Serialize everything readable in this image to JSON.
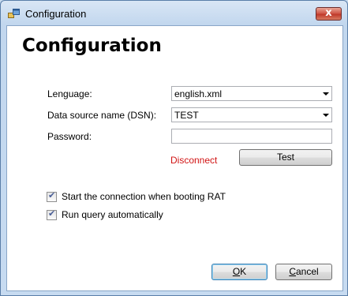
{
  "window": {
    "title": "Configuration",
    "close_glyph": "x",
    "icon": "app-window-icon"
  },
  "heading": "Configuration",
  "form": {
    "language_label": "Lenguage:",
    "language_value": "english.xml",
    "dsn_label": "Data source name (DSN):",
    "dsn_value": "TEST",
    "password_label": "Password:",
    "password_value": "",
    "status_text": "Disconnect",
    "test_button": "Test"
  },
  "options": [
    {
      "label": "Start the connection when booting RAT",
      "checked": true
    },
    {
      "label": "Run query automatically",
      "checked": true
    }
  ],
  "footer": {
    "ok_underlined": "O",
    "ok_rest": "K",
    "cancel_underlined": "C",
    "cancel_rest": "ancel"
  },
  "colors": {
    "status": "#d11414",
    "titlebar": "#c2d7ee",
    "close_button": "#c03a2b"
  }
}
